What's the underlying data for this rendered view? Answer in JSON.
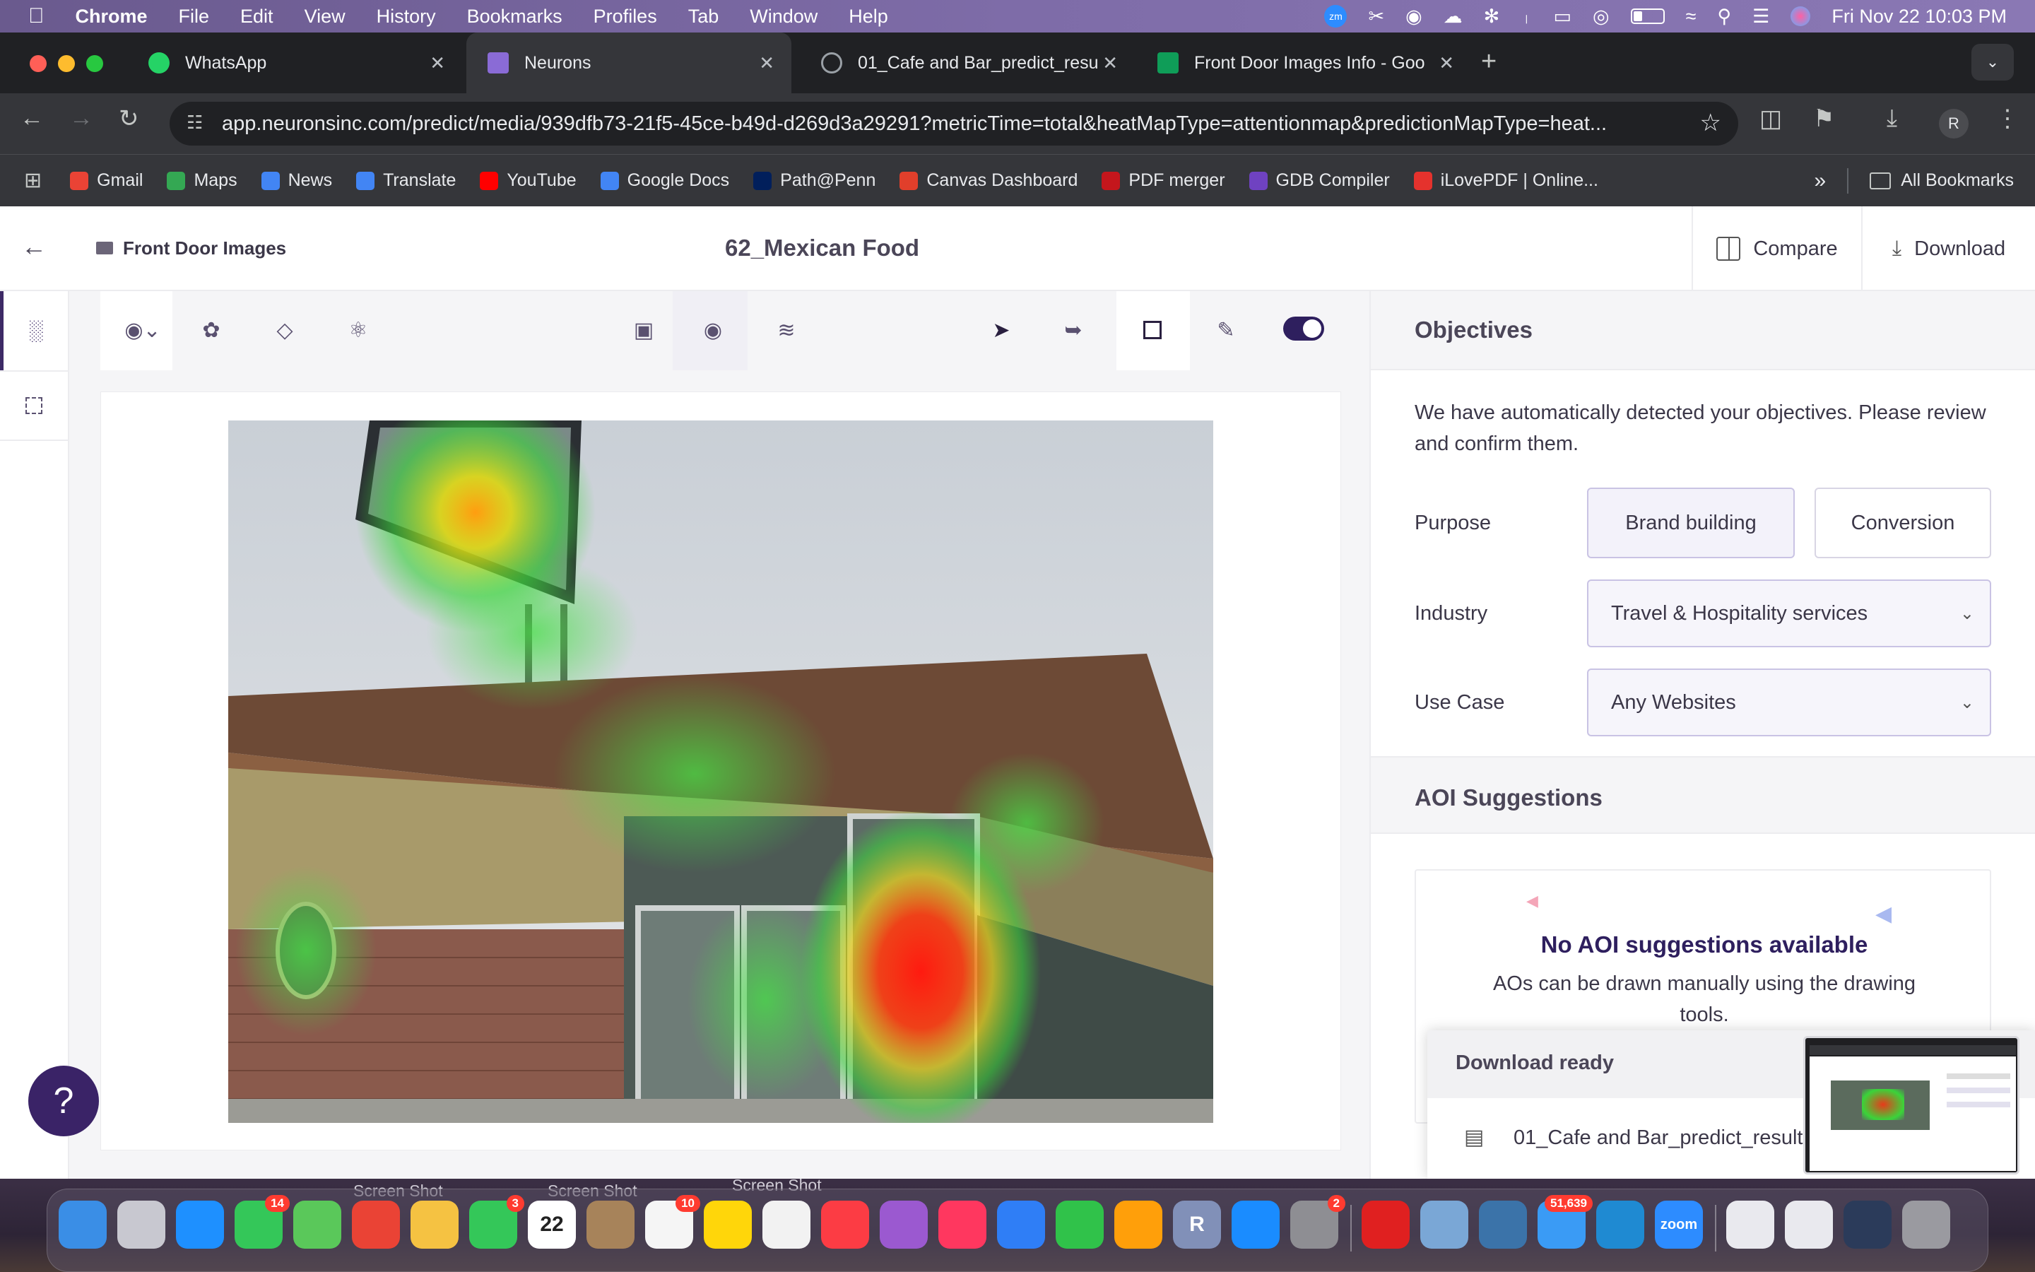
{
  "menubar": {
    "app": "Chrome",
    "items": [
      "File",
      "Edit",
      "View",
      "History",
      "Bookmarks",
      "Profiles",
      "Tab",
      "Window",
      "Help"
    ],
    "datetime": "Fri Nov 22  10:03 PM"
  },
  "tabs": [
    {
      "title": "WhatsApp",
      "color": "#25d366"
    },
    {
      "title": "Neurons",
      "color": "#8a6bd6"
    },
    {
      "title": "01_Cafe and Bar_predict_resu",
      "color": "#9aa0a6"
    },
    {
      "title": "Front Door Images Info - Goo",
      "color": "#0f9d58"
    }
  ],
  "omnibox": {
    "url": "app.neuronsinc.com/predict/media/939dfb73-21f5-45ce-b49d-d269d3a29291?metricTime=total&heatMapType=attentionmap&predictionMapType=heat..."
  },
  "profile_initial": "R",
  "bookmarks": [
    {
      "label": "Gmail",
      "color": "#ea4335"
    },
    {
      "label": "Maps",
      "color": "#34a853"
    },
    {
      "label": "News",
      "color": "#4285f4"
    },
    {
      "label": "Translate",
      "color": "#4285f4"
    },
    {
      "label": "YouTube",
      "color": "#ff0000"
    },
    {
      "label": "Google Docs",
      "color": "#4285f4"
    },
    {
      "label": "Path@Penn",
      "color": "#011f5b"
    },
    {
      "label": "Canvas Dashboard",
      "color": "#e13f2b"
    },
    {
      "label": "PDF merger",
      "color": "#c4161c"
    },
    {
      "label": "GDB Compiler",
      "color": "#6f42c1"
    },
    {
      "label": "iLovePDF | Online...",
      "color": "#e5322d"
    }
  ],
  "all_bookmarks": "All Bookmarks",
  "header": {
    "breadcrumb": "Front Door Images",
    "title": "62_Mexican Food",
    "compare": "Compare",
    "download": "Download"
  },
  "panel": {
    "objectives_title": "Objectives",
    "objectives_desc": "We have automatically detected your objectives. Please review and confirm them.",
    "purpose_label": "Purpose",
    "purpose_options": [
      "Brand building",
      "Conversion"
    ],
    "industry_label": "Industry",
    "industry_value": "Travel & Hospitality services",
    "usecase_label": "Use Case",
    "usecase_value": "Any Websites",
    "aoi_title": "AOI Suggestions",
    "aoi_empty_title": "No AOI suggestions available",
    "aoi_empty_desc": "AOs can be drawn manually using the drawing tools."
  },
  "toast": {
    "title": "Download ready",
    "file": "01_Cafe and Bar_predict_result"
  },
  "help_button": "?",
  "desktop_labels": [
    "Screen Shot",
    "Screen Shot",
    "Screen Shot"
  ],
  "dock": {
    "apps": [
      {
        "name": "finder-icon",
        "color": "#3a8ee6"
      },
      {
        "name": "launchpad-icon",
        "color": "#c8c8d0"
      },
      {
        "name": "safari-icon",
        "color": "#1e90ff"
      },
      {
        "name": "messages-icon",
        "color": "#34c759",
        "badge": "14"
      },
      {
        "name": "maps-icon",
        "color": "#5ac85a"
      },
      {
        "name": "chrome-icon",
        "color": "#ea4335"
      },
      {
        "name": "photos-icon",
        "color": "#f5c242"
      },
      {
        "name": "facetime-icon",
        "color": "#34c759",
        "badge": "3"
      },
      {
        "name": "calendar-icon",
        "color": "#ffffff",
        "text": "22"
      },
      {
        "name": "contacts-icon",
        "color": "#a7835a"
      },
      {
        "name": "reminders-icon",
        "color": "#f5f5f5",
        "badge": "10"
      },
      {
        "name": "notes-icon",
        "color": "#ffd60a"
      },
      {
        "name": "freeform-icon",
        "color": "#f2f2f2"
      },
      {
        "name": "music-icon",
        "color": "#fc3c44"
      },
      {
        "name": "podcasts-icon",
        "color": "#9b59d0"
      },
      {
        "name": "news-icon",
        "color": "#ff375f"
      },
      {
        "name": "keynote-icon",
        "color": "#2f7ef6"
      },
      {
        "name": "numbers-icon",
        "color": "#30c24a"
      },
      {
        "name": "pages-icon",
        "color": "#ff9f0a"
      },
      {
        "name": "r-icon",
        "color": "#8190b8",
        "text": "R"
      },
      {
        "name": "appstore-icon",
        "color": "#1a8cff"
      },
      {
        "name": "settings-icon",
        "color": "#8e8e93",
        "badge": "2"
      },
      {
        "name": "acrobat-icon",
        "color": "#e02020"
      },
      {
        "name": "scissors-icon",
        "color": "#7aa7d6"
      },
      {
        "name": "python-icon",
        "color": "#3b73a9"
      },
      {
        "name": "mail-icon",
        "color": "#3a9bf5",
        "badge": "51,639"
      },
      {
        "name": "vscode-icon",
        "color": "#1f8ad2"
      },
      {
        "name": "zoom-icon",
        "color": "#2d8cff",
        "text": "zoom"
      },
      {
        "name": "doc-thumb-1-icon",
        "color": "#e9e9ee"
      },
      {
        "name": "doc-thumb-2-icon",
        "color": "#e9e9ee"
      },
      {
        "name": "doc-thumb-3-icon",
        "color": "#2b3b5a"
      },
      {
        "name": "trash-icon",
        "color": "#9a9aa0"
      }
    ]
  },
  "colors": {
    "accent": "#3d2a66",
    "toggle": "#2e1f5e",
    "help": "#3a2367"
  }
}
